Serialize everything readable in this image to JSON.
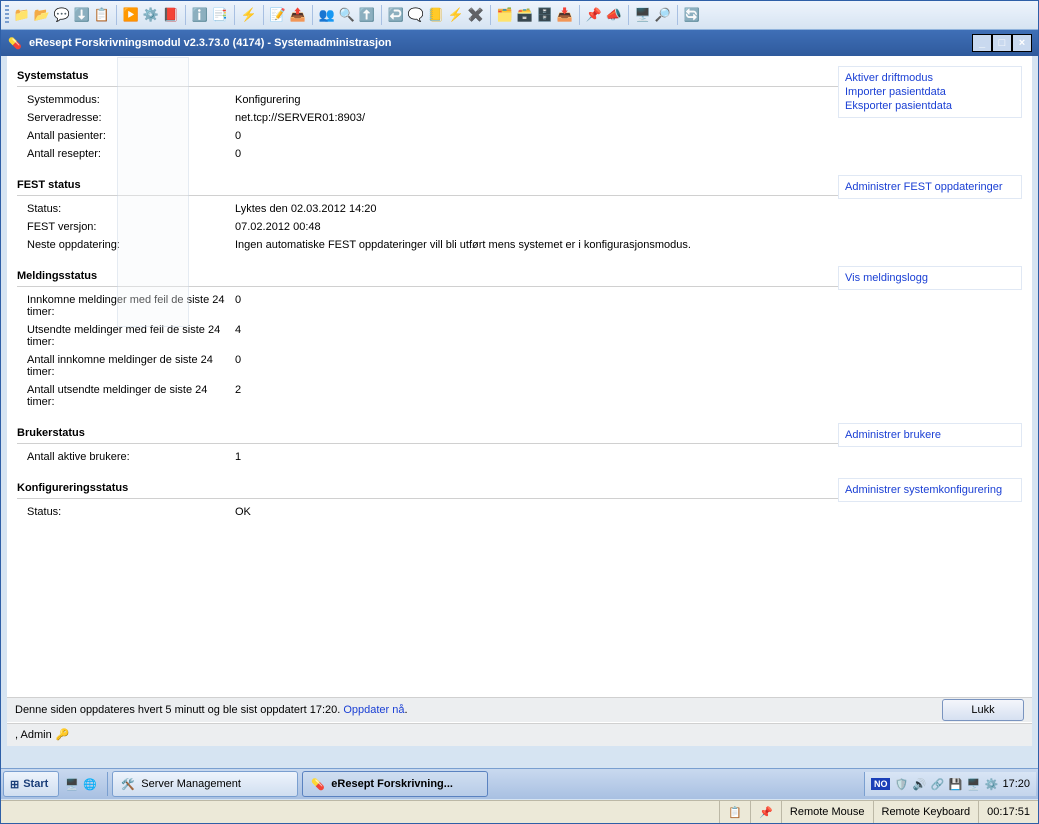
{
  "toolbar_icons": [
    "📁",
    "📂",
    "💬",
    "⬇️",
    "📋",
    "▶️",
    "⚙️",
    "📕",
    "ℹ️",
    "📑",
    "⚡",
    "📝",
    "📤",
    "👥",
    "🔍",
    "⬆️",
    "↩️",
    "🗨️",
    "📒",
    "⚡",
    "✖️",
    "🗂️",
    "🗃️",
    "🗄️",
    "📥",
    "📌",
    "📣",
    "🖥️",
    "🔎",
    "🔄"
  ],
  "window": {
    "title": "eResept Forskrivningsmodul v2.3.73.0 (4174) - Systemadministrasjon"
  },
  "systemstatus": {
    "heading": "Systemstatus",
    "rows": [
      {
        "label": "Systemmodus:",
        "value": "Konfigurering"
      },
      {
        "label": "Serveradresse:",
        "value": "net.tcp://SERVER01:8903/"
      },
      {
        "label": "Antall pasienter:",
        "value": "0"
      },
      {
        "label": "Antall resepter:",
        "value": "0"
      }
    ],
    "links": [
      "Aktiver driftmodus",
      "Importer pasientdata",
      "Eksporter pasientdata"
    ]
  },
  "fest": {
    "heading": "FEST status",
    "rows": [
      {
        "label": "Status:",
        "value": "Lyktes den 02.03.2012 14:20"
      },
      {
        "label": "FEST versjon:",
        "value": "07.02.2012 00:48"
      },
      {
        "label": "Neste oppdatering:",
        "value": "Ingen automatiske FEST oppdateringer vill bli utført mens systemet er i konfigurasjonsmodus."
      }
    ],
    "links": [
      "Administrer FEST oppdateringer"
    ]
  },
  "melding": {
    "heading": "Meldingsstatus",
    "rows": [
      {
        "label": "Innkomne meldinger med feil de siste 24 timer:",
        "value": "0"
      },
      {
        "label": "Utsendte meldinger med feil de siste 24 timer:",
        "value": "4"
      },
      {
        "label": "Antall innkomne meldinger de siste 24 timer:",
        "value": "0"
      },
      {
        "label": "Antall utsendte meldinger de siste 24 timer:",
        "value": "2"
      }
    ],
    "links": [
      "Vis meldingslogg"
    ]
  },
  "bruker": {
    "heading": "Brukerstatus",
    "rows": [
      {
        "label": "Antall aktive brukere:",
        "value": "1"
      }
    ],
    "links": [
      "Administrer brukere"
    ]
  },
  "konfig": {
    "heading": "Konfigureringsstatus",
    "rows": [
      {
        "label": "Status:",
        "value": "OK"
      }
    ],
    "links": [
      "Administrer systemkonfigurering"
    ]
  },
  "footer": {
    "text": "Denne siden oppdateres hvert 5 minutt og ble sist oppdatert 17:20. ",
    "refresh_link": "Oppdater nå",
    "close_button": "Lukk",
    "user": ", Admin"
  },
  "taskbar": {
    "start": "Start",
    "tasks": [
      {
        "label": "Server Management",
        "active": false,
        "icon": "🛠️"
      },
      {
        "label": "eResept Forskrivning...",
        "active": true,
        "icon": "💊"
      }
    ],
    "lang": "NO",
    "clock": "17:20"
  },
  "remote": {
    "mouse": "Remote Mouse",
    "keyboard": "Remote Keyboard",
    "time": "00:17:51"
  }
}
